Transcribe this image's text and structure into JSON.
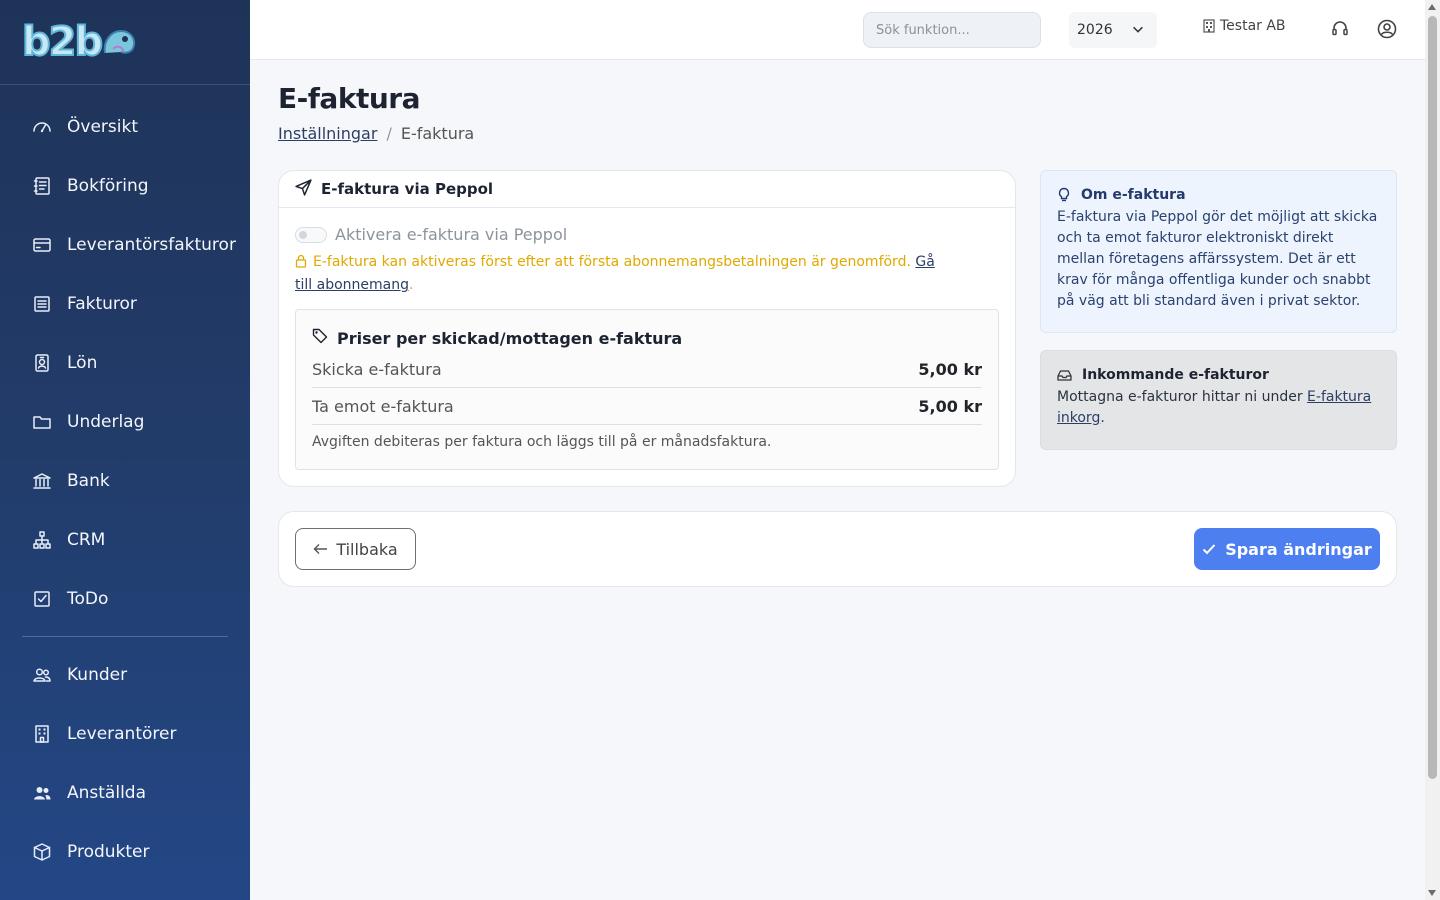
{
  "brand": {
    "logo_text": "b2b"
  },
  "sidebar": {
    "items_primary": [
      {
        "label": "Översikt",
        "icon": "speedometer-icon"
      },
      {
        "label": "Bokföring",
        "icon": "journal-icon"
      },
      {
        "label": "Leverantörsfakturor",
        "icon": "credit-card-icon"
      },
      {
        "label": "Fakturor",
        "icon": "receipt-icon"
      },
      {
        "label": "Lön",
        "icon": "person-badge-icon"
      },
      {
        "label": "Underlag",
        "icon": "folder-icon"
      },
      {
        "label": "Bank",
        "icon": "bank-icon"
      },
      {
        "label": "CRM",
        "icon": "diagram-icon"
      },
      {
        "label": "ToDo",
        "icon": "check-square-icon"
      }
    ],
    "items_secondary": [
      {
        "label": "Kunder",
        "icon": "people-icon"
      },
      {
        "label": "Leverantörer",
        "icon": "building-icon"
      },
      {
        "label": "Anställda",
        "icon": "people-fill-icon"
      },
      {
        "label": "Produkter",
        "icon": "box-icon"
      }
    ]
  },
  "topbar": {
    "search_placeholder": "Sök funktion...",
    "year": "2026",
    "company": "Testar AB"
  },
  "page": {
    "title": "E-faktura",
    "breadcrumb": {
      "parent": "Inställningar",
      "current": "E-faktura"
    }
  },
  "main_card": {
    "title": "E-faktura via Peppol",
    "toggle_label": "Aktivera e-faktura via Peppol",
    "toggle_on": false,
    "warning_text": "E-faktura kan aktiveras först efter att första abonnemangsbetalningen är genomförd.",
    "warning_link": "Gå till abonnemang",
    "prices": {
      "title": "Priser per skickad/mottagen e-faktura",
      "rows": [
        {
          "label": "Skicka e-faktura",
          "value": "5,00 kr"
        },
        {
          "label": "Ta emot e-faktura",
          "value": "5,00 kr"
        }
      ],
      "note": "Avgiften debiteras per faktura och läggs till på er månadsfaktura."
    }
  },
  "info_card": {
    "title": "Om e-faktura",
    "body": "E-faktura via Peppol gör det möjligt att skicka och ta emot fakturor elektroniskt direkt mellan företagens affärssystem. Det är ett krav för många offentliga kunder och snabbt på väg att bli standard även i privat sektor."
  },
  "incoming_card": {
    "title": "Inkommande e-fakturor",
    "body_prefix": "Mottagna e-fakturor hittar ni under ",
    "link": "E-faktura inkorg",
    "body_suffix": "."
  },
  "actions": {
    "back_label": "Tillbaka",
    "save_label": "Spara ändringar"
  },
  "colors": {
    "sidebar": "#1e3358",
    "primary": "#4e7ff0",
    "warning": "#e0a800",
    "info_bg": "#eef4fd"
  }
}
